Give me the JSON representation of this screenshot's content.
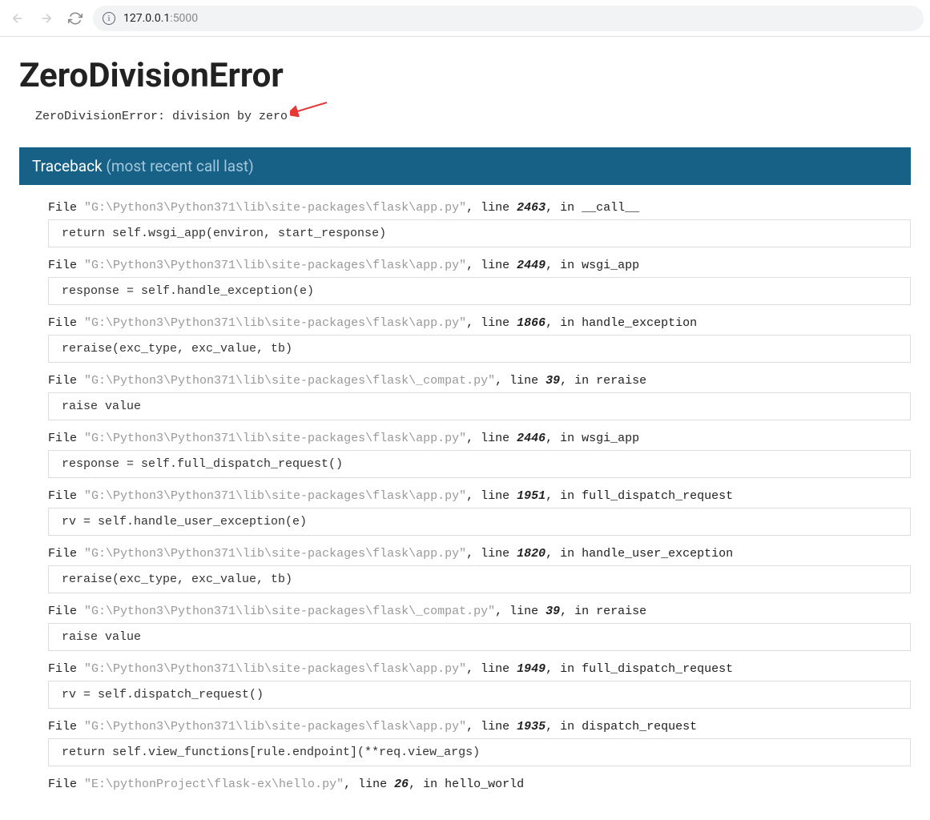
{
  "browser": {
    "url_host": "127.0.0.1",
    "url_port": ":5000"
  },
  "error": {
    "title": "ZeroDivisionError",
    "message": "ZeroDivisionError: division by zero"
  },
  "traceback": {
    "header_primary": "Traceback ",
    "header_secondary": "(most recent call last)",
    "frames": [
      {
        "file_prefix": "File ",
        "path": "\"G:\\Python3\\Python371\\lib\\site-packages\\flask\\app.py\"",
        "line_label": ", line ",
        "line_num": "2463",
        "in_label": ", in ",
        "func": "__call__",
        "code": "return self.wsgi_app(environ, start_response)"
      },
      {
        "file_prefix": "File ",
        "path": "\"G:\\Python3\\Python371\\lib\\site-packages\\flask\\app.py\"",
        "line_label": ", line ",
        "line_num": "2449",
        "in_label": ", in ",
        "func": "wsgi_app",
        "code": "response = self.handle_exception(e)"
      },
      {
        "file_prefix": "File ",
        "path": "\"G:\\Python3\\Python371\\lib\\site-packages\\flask\\app.py\"",
        "line_label": ", line ",
        "line_num": "1866",
        "in_label": ", in ",
        "func": "handle_exception",
        "code": "reraise(exc_type, exc_value, tb)"
      },
      {
        "file_prefix": "File ",
        "path": "\"G:\\Python3\\Python371\\lib\\site-packages\\flask\\_compat.py\"",
        "line_label": ", line ",
        "line_num": "39",
        "in_label": ", in ",
        "func": "reraise",
        "code": "raise value"
      },
      {
        "file_prefix": "File ",
        "path": "\"G:\\Python3\\Python371\\lib\\site-packages\\flask\\app.py\"",
        "line_label": ", line ",
        "line_num": "2446",
        "in_label": ", in ",
        "func": "wsgi_app",
        "code": "response = self.full_dispatch_request()"
      },
      {
        "file_prefix": "File ",
        "path": "\"G:\\Python3\\Python371\\lib\\site-packages\\flask\\app.py\"",
        "line_label": ", line ",
        "line_num": "1951",
        "in_label": ", in ",
        "func": "full_dispatch_request",
        "code": "rv = self.handle_user_exception(e)"
      },
      {
        "file_prefix": "File ",
        "path": "\"G:\\Python3\\Python371\\lib\\site-packages\\flask\\app.py\"",
        "line_label": ", line ",
        "line_num": "1820",
        "in_label": ", in ",
        "func": "handle_user_exception",
        "code": "reraise(exc_type, exc_value, tb)"
      },
      {
        "file_prefix": "File ",
        "path": "\"G:\\Python3\\Python371\\lib\\site-packages\\flask\\_compat.py\"",
        "line_label": ", line ",
        "line_num": "39",
        "in_label": ", in ",
        "func": "reraise",
        "code": "raise value"
      },
      {
        "file_prefix": "File ",
        "path": "\"G:\\Python3\\Python371\\lib\\site-packages\\flask\\app.py\"",
        "line_label": ", line ",
        "line_num": "1949",
        "in_label": ", in ",
        "func": "full_dispatch_request",
        "code": "rv = self.dispatch_request()"
      },
      {
        "file_prefix": "File ",
        "path": "\"G:\\Python3\\Python371\\lib\\site-packages\\flask\\app.py\"",
        "line_label": ", line ",
        "line_num": "1935",
        "in_label": ", in ",
        "func": "dispatch_request",
        "code": "return self.view_functions[rule.endpoint](**req.view_args)"
      },
      {
        "file_prefix": "File ",
        "path": "\"E:\\pythonProject\\flask-ex\\hello.py\"",
        "line_label": ", line ",
        "line_num": "26",
        "in_label": ", in ",
        "func": "hello_world",
        "code": ""
      }
    ]
  }
}
